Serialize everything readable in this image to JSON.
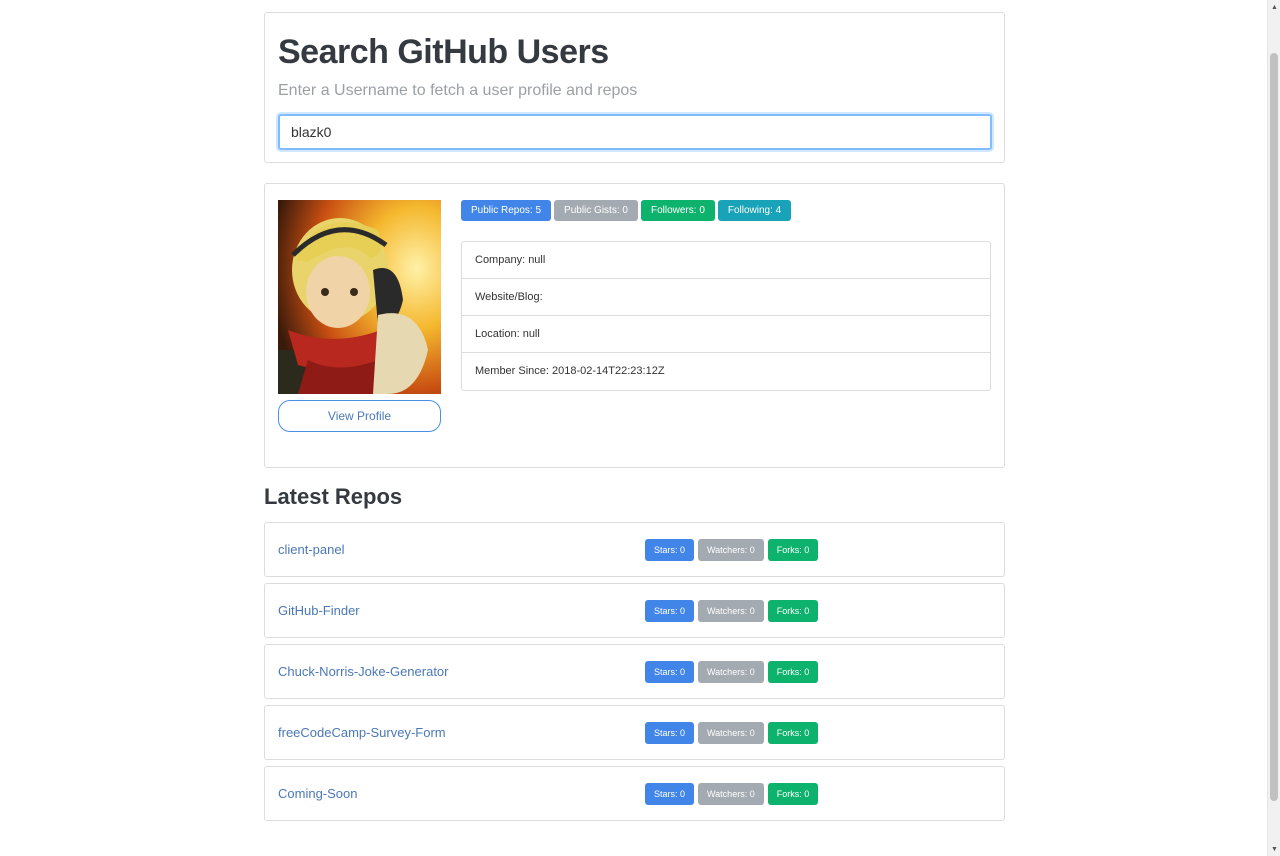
{
  "search": {
    "title": "Search GitHub Users",
    "subtitle": "Enter a Username to fetch a user profile and repos",
    "value": "blazk0"
  },
  "profile": {
    "view_profile_label": "View Profile",
    "badges": {
      "public_repos": "Public Repos: 5",
      "public_gists": "Public Gists: 0",
      "followers": "Followers: 0",
      "following": "Following: 4"
    },
    "info": {
      "company": "Company: null",
      "website": "Website/Blog:",
      "location": "Location: null",
      "member_since": "Member Since: 2018-02-14T22:23:12Z"
    }
  },
  "repos": {
    "heading": "Latest Repos",
    "items": [
      {
        "name": "client-panel",
        "stars": "Stars: 0",
        "watchers": "Watchers: 0",
        "forks": "Forks: 0"
      },
      {
        "name": "GitHub-Finder",
        "stars": "Stars: 0",
        "watchers": "Watchers: 0",
        "forks": "Forks: 0"
      },
      {
        "name": "Chuck-Norris-Joke-Generator",
        "stars": "Stars: 0",
        "watchers": "Watchers: 0",
        "forks": "Forks: 0"
      },
      {
        "name": "freeCodeCamp-Survey-Form",
        "stars": "Stars: 0",
        "watchers": "Watchers: 0",
        "forks": "Forks: 0"
      },
      {
        "name": "Coming-Soon",
        "stars": "Stars: 0",
        "watchers": "Watchers: 0",
        "forks": "Forks: 0"
      }
    ]
  },
  "colors": {
    "primary": "#4285e8",
    "secondary": "#a4aab1",
    "success": "#0db36c",
    "info": "#18a3b8",
    "link": "#4a78b8"
  },
  "icons": {
    "scroll_up": "scroll-up-arrow-icon",
    "scroll_down": "scroll-down-arrow-icon"
  }
}
